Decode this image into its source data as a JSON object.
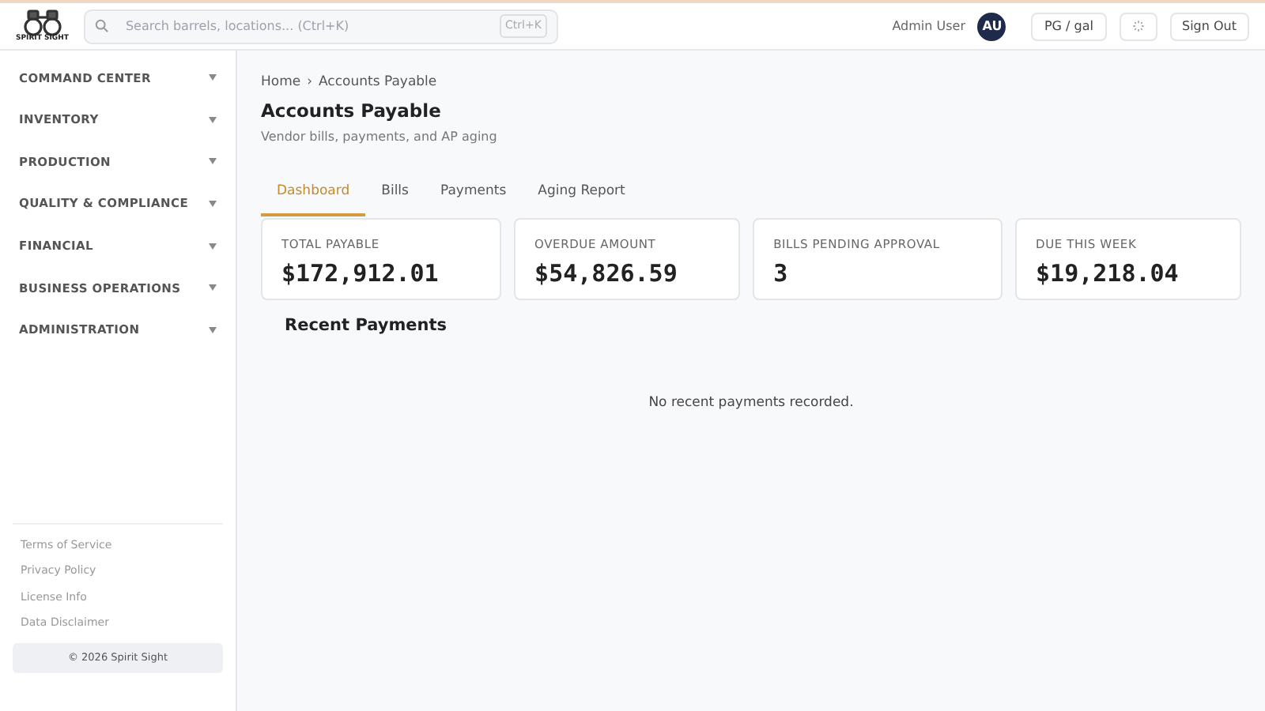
{
  "header": {
    "logo_text": "SPIRIT SIGHT",
    "search": {
      "placeholder": "Search barrels, locations... (Ctrl+K)",
      "shortcut": "Ctrl+K"
    },
    "user_name": "Admin User",
    "avatar": "AU",
    "unit_button": "PG / gal",
    "sign_out": "Sign Out"
  },
  "sidebar": {
    "items": [
      {
        "label": "COMMAND CENTER",
        "expanded": false
      },
      {
        "label": "INVENTORY",
        "expanded": false
      },
      {
        "label": "PRODUCTION",
        "expanded": false
      },
      {
        "label": "QUALITY & COMPLIANCE",
        "expanded": false
      },
      {
        "label": "FINANCIAL",
        "expanded": false
      },
      {
        "label": "BUSINESS OPERATIONS",
        "expanded": false
      },
      {
        "label": "ADMINISTRATION",
        "expanded": false
      }
    ],
    "footer_links": [
      "Terms of Service",
      "Privacy Policy",
      "License Info",
      "Data Disclaimer"
    ],
    "copyright": "© 2026 Spirit Sight"
  },
  "breadcrumb": {
    "items": [
      "Home",
      "Accounts Payable"
    ],
    "separator": "›"
  },
  "page": {
    "title": "Accounts Payable",
    "subtitle": "Vendor bills, payments, and AP aging"
  },
  "tabs": [
    {
      "label": "Dashboard",
      "selected": true
    },
    {
      "label": "Bills",
      "selected": false
    },
    {
      "label": "Payments",
      "selected": false
    },
    {
      "label": "Aging Report",
      "selected": false
    }
  ],
  "stats": [
    {
      "label": "TOTAL PAYABLE",
      "value": "$172,912.01"
    },
    {
      "label": "OVERDUE AMOUNT",
      "value": "$54,826.59"
    },
    {
      "label": "BILLS PENDING APPROVAL",
      "value": "3"
    },
    {
      "label": "DUE THIS WEEK",
      "value": "$19,218.04"
    }
  ],
  "recent_payments": {
    "title": "Recent Payments",
    "empty_message": "No recent payments recorded."
  }
}
